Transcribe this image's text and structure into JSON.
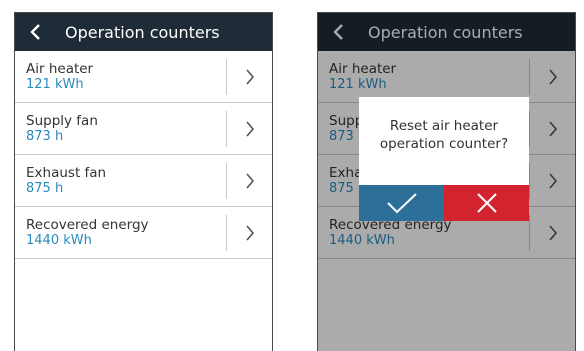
{
  "header": {
    "title": "Operation counters"
  },
  "counters": [
    {
      "label": "Air heater",
      "value": "121 kWh"
    },
    {
      "label": "Supply fan",
      "value": "873 h"
    },
    {
      "label": "Exhaust fan",
      "value": "875 h"
    },
    {
      "label": "Recovered energy",
      "value": "1440 kWh"
    }
  ],
  "dialog": {
    "line1": "Reset air heater",
    "line2": "operation counter?"
  },
  "icons": {
    "back": "chevron-left-icon",
    "row": "chevron-right-icon",
    "confirm": "check-icon",
    "cancel": "close-icon"
  },
  "colors": {
    "header_bg": "#1f2b36",
    "value_text": "#2a8bbf",
    "confirm_bg": "#2c6f99",
    "cancel_bg": "#d3232f"
  }
}
